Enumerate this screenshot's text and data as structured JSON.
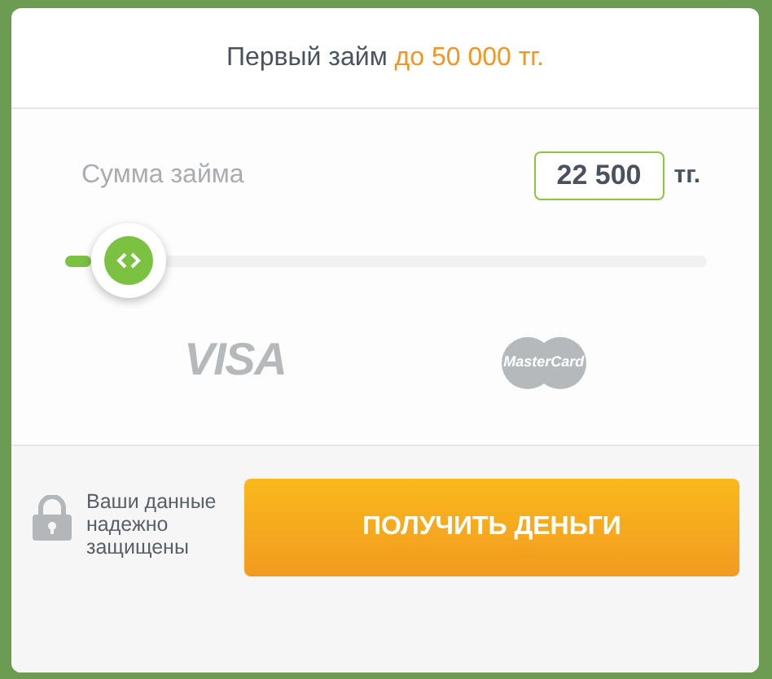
{
  "header": {
    "title": "Первый займ",
    "highlight": "до 50 000 тг."
  },
  "amount": {
    "label": "Сумма займа",
    "value": "22 500",
    "unit": "тг."
  },
  "slider": {
    "level": 0.1
  },
  "payment_logos": [
    "VISA",
    "MasterCard"
  ],
  "security_note": "Ваши данные надежно защищены",
  "submit_button": "ПОЛУЧИТЬ ДЕНЬГИ"
}
